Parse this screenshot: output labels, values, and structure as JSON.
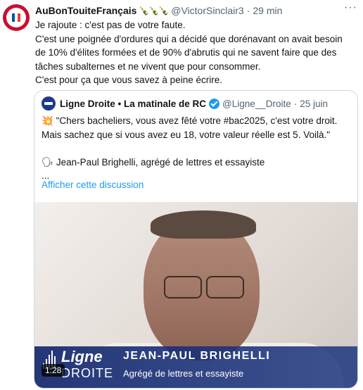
{
  "post": {
    "author_name": "AuBonTouiteFrançais",
    "author_emoji": "🍾🍾🍾",
    "handle": "@VictorSinclair3",
    "dot": "·",
    "time": "29 min",
    "more_label": "···",
    "text_lines": [
      "Je rajoute : c'est pas de votre faute.",
      "C'est une poignée d'ordures qui a décidé que dorénavant on avait besoin",
      "de 10% d'élites formées et de 90% d'abrutis qui ne savent faire que des",
      "tâches subalternes et ne vivent que pour consommer.",
      "C'est pour ça que vous savez à peine écrire."
    ]
  },
  "quote": {
    "author_name": "Ligne Droite • La matinale de RC",
    "handle": "@Ligne__Droite",
    "dot": "·",
    "time": "25 juin",
    "spark_emoji": "💥",
    "line1": "\"Chers bacheliers, vous avez fêté votre #bac2025, c'est votre droit.",
    "line2": "Mais sachez que si vous avez eu 18, votre valeur réelle est 5. Voilà.\"",
    "speaker_emoji": "🗣",
    "line3": "Jean-Paul Brighelli, agrégé de lettres et essayiste",
    "ellipsis": "...",
    "show_thread": "Afficher cette discussion"
  },
  "video": {
    "logo_line1": "Ligne",
    "logo_line2": "DROITE",
    "lower_third_name": "JEAN-PAUL BRIGHELLI",
    "lower_third_role": "Agrégé de lettres et essayiste",
    "duration": "1:28"
  },
  "colors": {
    "link": "#1d9bf0",
    "muted": "#536471",
    "verified": "#1d9bf0",
    "lower_third": "#1e3782"
  }
}
